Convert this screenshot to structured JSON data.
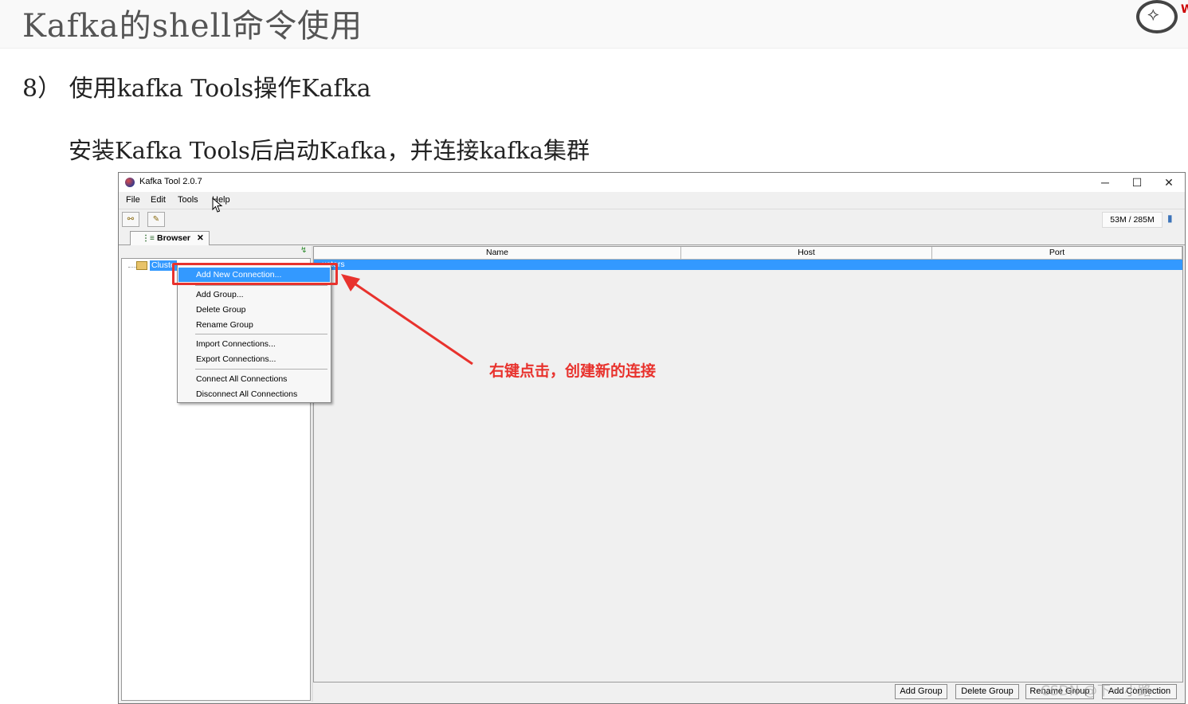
{
  "slide": {
    "title": "Kafka的shell命令使用",
    "subtitle": "8） 使用kafka Tools操作Kafka",
    "description": "安装Kafka Tools后启动Kafka，并连接kafka集群",
    "annotation": "右键点击，创建新的连接",
    "watermark": "CSDN @下一小路"
  },
  "window": {
    "title": "Kafka Tool  2.0.7",
    "controls": {
      "minimize": "─",
      "maximize": "☐",
      "close": "✕"
    },
    "menu": [
      "File",
      "Edit",
      "Tools",
      "Help"
    ],
    "memory": "53M / 285M",
    "tab": {
      "label": "Browser",
      "close": "✕"
    },
    "tree": {
      "root": "Cluste"
    },
    "table": {
      "columns": [
        "Name",
        "Host",
        "Port"
      ],
      "rows": [
        {
          "name": "usters"
        }
      ]
    },
    "bottom_buttons": [
      "Add Group",
      "Delete Group",
      "Rename Group",
      "Add Connection"
    ],
    "context_menu": {
      "items": [
        "Add New Connection...",
        "Add Group...",
        "Delete Group",
        "Rename Group",
        "Import Connections...",
        "Export Connections...",
        "Connect All Connections",
        "Disconnect All Connections"
      ],
      "active_index": 0
    }
  },
  "colors": {
    "accent": "#3399ff",
    "annotation": "#e8322d"
  }
}
